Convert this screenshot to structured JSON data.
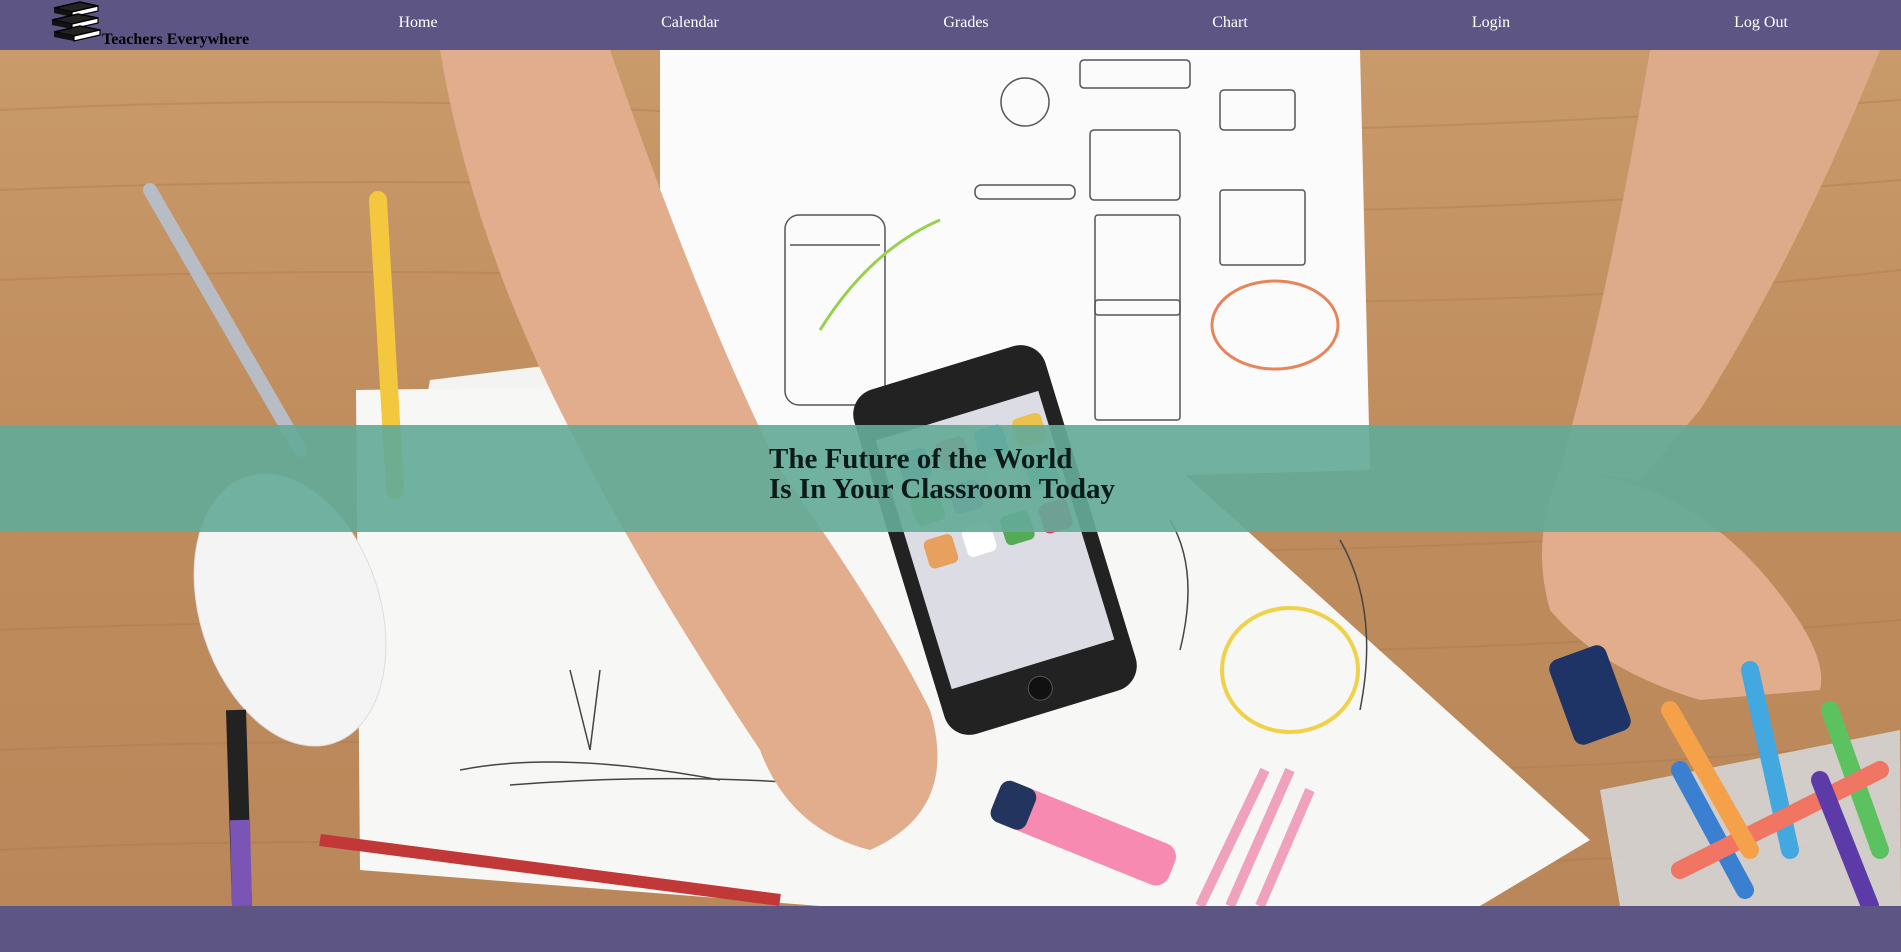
{
  "brand": {
    "name": "Teachers Everywhere",
    "icon": "books-stack-icon"
  },
  "nav": {
    "home": "Home",
    "calendar": "Calendar",
    "grades": "Grades",
    "chart": "Chart",
    "login": "Login",
    "logout": "Log Out"
  },
  "hero": {
    "line1": "The Future of the World",
    "line2": "Is In Your Classroom Today",
    "image": "desk-with-wireframe-sketches-phone-and-markers"
  },
  "colors": {
    "navbar": "#5d5685",
    "banner": "#64aa98",
    "nav_text": "#ffffff",
    "headline": "#0d1a1a"
  }
}
